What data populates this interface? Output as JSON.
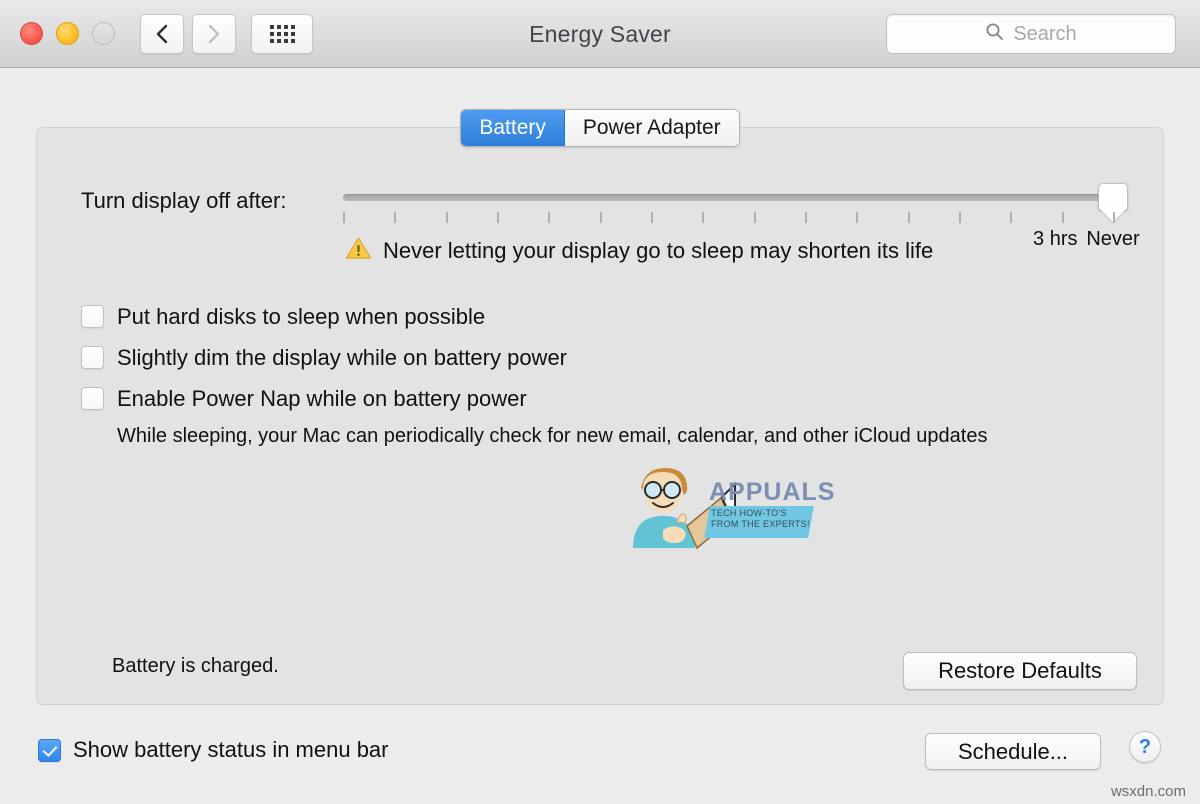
{
  "window": {
    "title": "Energy Saver",
    "traffic_lights": [
      "close",
      "minimize",
      "zoom"
    ],
    "nav": {
      "back": "back-arrow",
      "forward": "forward-arrow",
      "show_all": "grid-icon"
    },
    "search": {
      "placeholder": "Search",
      "value": "",
      "icon": "search-icon"
    }
  },
  "tabs": [
    {
      "label": "Battery",
      "selected": true
    },
    {
      "label": "Power Adapter",
      "selected": false
    }
  ],
  "slider": {
    "label": "Turn display off after:",
    "tick_count": 16,
    "knob_position_percent": 100,
    "scale_labels": [
      {
        "text": "3 hrs",
        "position_percent": 92.5
      },
      {
        "text": "Never",
        "position_percent": 100
      }
    ]
  },
  "warning": {
    "icon": "warning-triangle-icon",
    "text": "Never letting your display go to sleep may shorten its life"
  },
  "checkboxes": [
    {
      "label": "Put hard disks to sleep when possible",
      "checked": false
    },
    {
      "label": "Slightly dim the display while on battery power",
      "checked": false
    },
    {
      "label": "Enable Power Nap while on battery power",
      "checked": false
    }
  ],
  "power_nap_description": "While sleeping, your Mac can periodically check for new email, calendar, and other iCloud updates",
  "battery_status": "Battery is charged.",
  "buttons": {
    "restore_defaults": "Restore Defaults",
    "schedule": "Schedule...",
    "help": "?"
  },
  "menu_bar_checkbox": {
    "label": "Show battery status in menu bar",
    "checked": true
  },
  "watermarks": {
    "appuals_name": "APPUALS",
    "appuals_tagline": "TECH HOW-TO'S FROM THE EXPERTS!",
    "site": "wsxdn.com"
  },
  "colors": {
    "accent_blue": "#2f7fd8",
    "window_bg": "#ececec",
    "panel_bg": "#e3e3e3",
    "warning_yellow": "#f6c game",
    "traffic_red": "#fb5f52",
    "traffic_yellow": "#fdc22a"
  }
}
